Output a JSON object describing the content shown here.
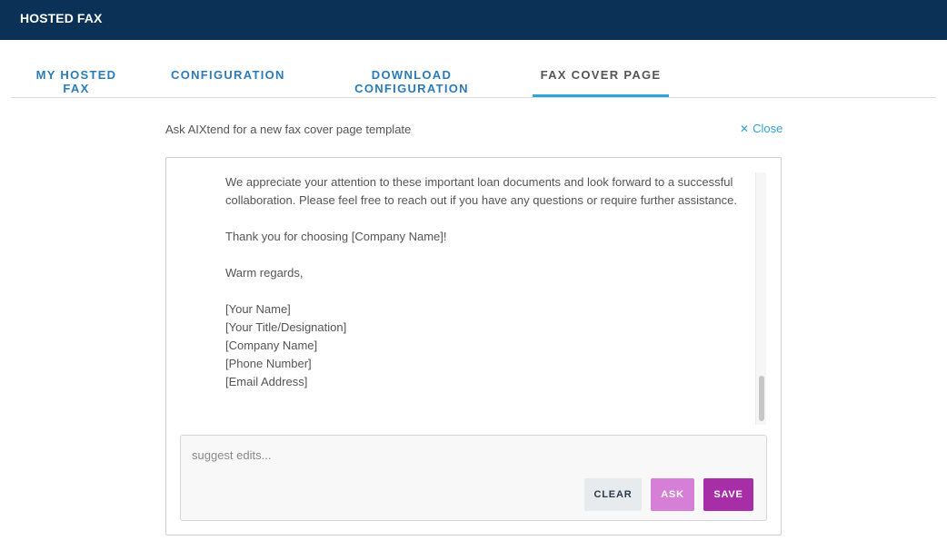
{
  "header": {
    "title": "HOSTED FAX"
  },
  "tabs": [
    {
      "label": "MY HOSTED FAX"
    },
    {
      "label": "CONFIGURATION"
    },
    {
      "label": "DOWNLOAD CONFIGURATION"
    },
    {
      "label": "FAX COVER PAGE",
      "active": true
    }
  ],
  "ai_panel": {
    "title": "Ask AIXtend for a new fax cover page template",
    "close_label": "Close",
    "close_icon": "close-icon",
    "letter": {
      "paragraphs": [
        "We appreciate your attention to these important loan documents and look forward to a successful collaboration. Please feel free to reach out if you have any questions or require further assistance.",
        "Thank you for choosing [Company Name]!",
        "Warm regards,"
      ],
      "signature": [
        "[Your Name]",
        "[Your Title/Designation]",
        "[Company Name]",
        "[Phone Number]",
        "[Email Address]"
      ]
    },
    "edit": {
      "placeholder": "suggest edits...",
      "value": ""
    },
    "buttons": {
      "clear": "CLEAR",
      "ask": "ASK",
      "save": "SAVE"
    }
  },
  "colors": {
    "topbar": "#0b3157",
    "tab_text": "#2b7bb9",
    "tab_active_underline": "#2fa4d8",
    "close_link": "#2fa4d8",
    "ask_button": "#d67fd6",
    "save_button": "#a72ea6",
    "clear_button": "#e8ebee"
  }
}
